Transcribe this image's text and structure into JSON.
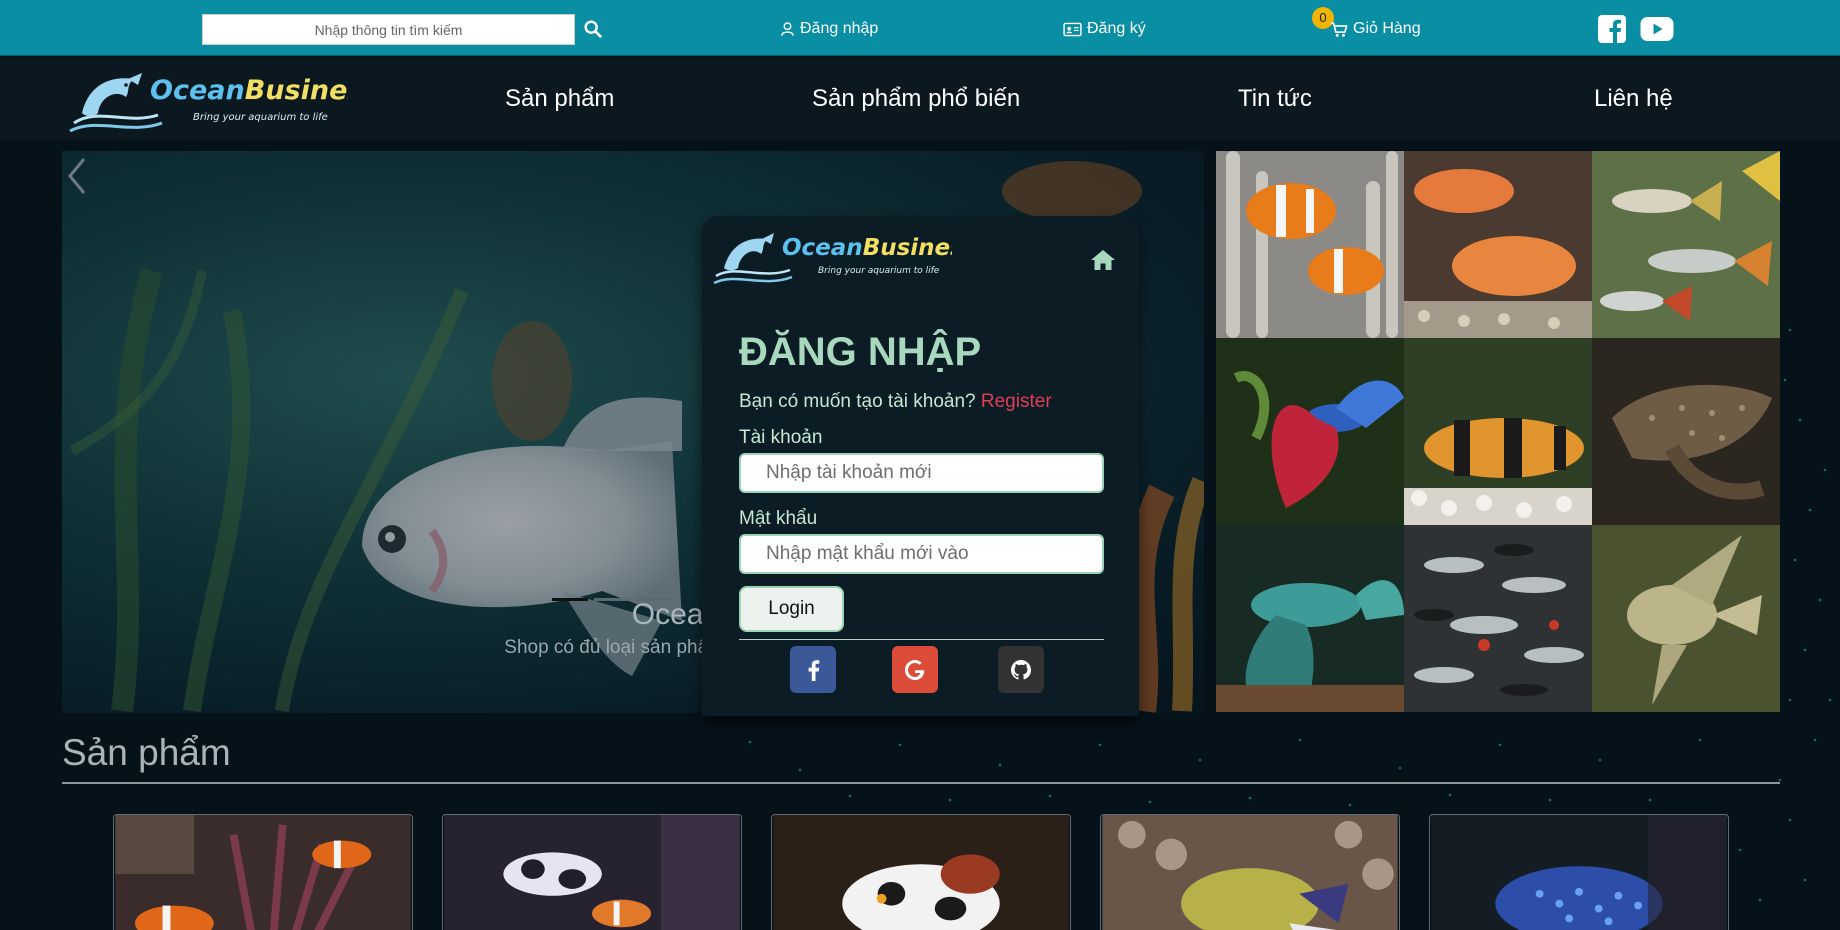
{
  "topbar": {
    "search_placeholder": "Nhập thông tin tìm kiếm",
    "login_label": "Đăng nhập",
    "register_label": "Đăng ký",
    "cart_label": "Giỏ Hàng",
    "cart_count": "0"
  },
  "brand": {
    "name_part1": "Ocean",
    "name_part2": "Business",
    "tagline": "Bring your aquarium to life"
  },
  "nav": {
    "items": [
      "Sản phẩm",
      "Sản phẩm phổ biến",
      "Tin tức",
      "Liên hệ"
    ]
  },
  "hero": {
    "caption_title": "Ocean Busine",
    "caption_sub": "Shop có đủ loại sản phẩm dành cho những"
  },
  "login": {
    "title": "ĐĂNG NHẬP",
    "question": "Bạn có muốn tạo tài khoản?",
    "register_link": "Register",
    "username_label": "Tài khoản",
    "username_placeholder": "Nhập tài khoản mới",
    "password_label": "Mật khẩu",
    "password_placeholder": "Nhập mật khẩu mới vào",
    "login_button": "Login"
  },
  "products": {
    "section_title": "Sản phẩm"
  },
  "colors": {
    "topbar": "#0a8ea3",
    "accent_title": "#a8d8be",
    "register_link": "#e33d55",
    "facebook": "#3b5998",
    "google": "#dd4b39",
    "github": "#333333"
  }
}
